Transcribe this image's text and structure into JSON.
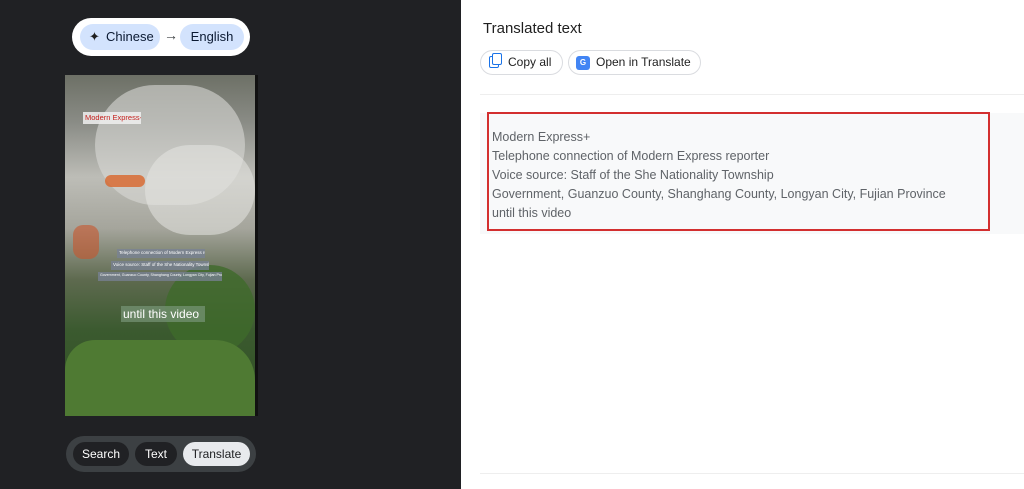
{
  "language_bar": {
    "source": "Chinese",
    "target": "English"
  },
  "video_overlay": {
    "label_top": "Modern Express+",
    "label_1": "Telephone connection of Modern Express reporter",
    "label_2": "Voice source: Staff of the She Nationality Township",
    "label_3": "Government, Guanzuo County, Shanghang County, Longyan City, Fujian Province",
    "label_big": "until this video"
  },
  "actions": {
    "search": "Search",
    "text": "Text",
    "translate": "Translate"
  },
  "panel": {
    "title": "Translated text",
    "copy_all": "Copy all",
    "open_in_translate": "Open in Translate"
  },
  "result": {
    "lines": [
      "Modern Express+",
      "Telephone connection of Modern Express reporter",
      "Voice source: Staff of the She Nationality Township",
      "Government, Guanzuo County, Shanghang County, Longyan City, Fujian Province",
      "until this video"
    ]
  },
  "colors": {
    "dark_bg": "#202124",
    "chip_blue": "#d3e3fd",
    "highlight_red": "#d32f2f"
  }
}
